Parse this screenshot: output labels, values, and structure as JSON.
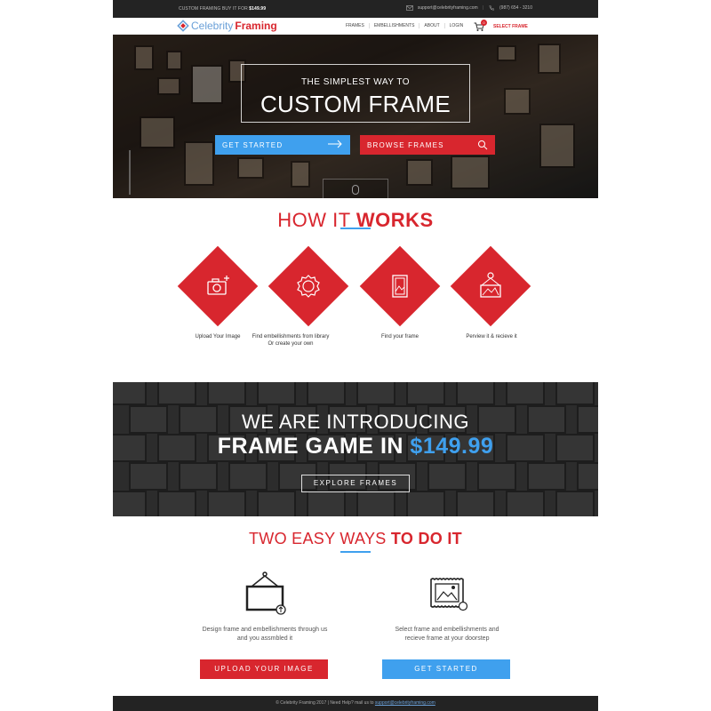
{
  "topbar": {
    "promo_text": "CUSTOM FRAMING BUY IT FOR",
    "promo_price": "$149.99",
    "email": "support@celebrityframing.com",
    "separator": "|",
    "phone": "(987) 654 - 3210"
  },
  "nav": {
    "logo_part1": "Celebrity",
    "logo_part2": "Framing",
    "menu": [
      "FRAMES",
      "EMBELLISHMENTS",
      "ABOUT",
      "LOGIN"
    ],
    "cart_count": "0",
    "select_frame": "SELECT FRAME"
  },
  "hero": {
    "line1": "THE SIMPLEST WAY TO",
    "line2": "CUSTOM FRAME",
    "get_started": "GET STARTED",
    "browse_frames": "BROWSE FRAMES"
  },
  "how": {
    "title_light": "HOW IT",
    "title_bold": "WORKS",
    "steps": [
      {
        "label": "Upload Your Image",
        "icon": "camera-icon"
      },
      {
        "label": "Find embellishments from library",
        "label2": "Or create your own",
        "icon": "badge-icon"
      },
      {
        "label": "Find your frame",
        "icon": "frame-icon"
      },
      {
        "label": "Perview it & recieve it",
        "icon": "hanging-picture-icon"
      }
    ]
  },
  "intro": {
    "line1": "WE ARE INTRODUCING",
    "line2_text": "FRAME GAME IN",
    "line2_price": "$149.99",
    "explore": "EXPLORE FRAMES"
  },
  "two_ways": {
    "title_light": "TWO EASY WAYS",
    "title_bold": "TO DO IT",
    "left_text1": "Design frame and embellishments through us",
    "left_text2": "and you assmbled it",
    "right_text1": "Select frame and embellishments and",
    "right_text2": "recieve frame at your doorstep",
    "upload_button": "UPLOAD YOUR IMAGE",
    "get_started_button": "GET STARTED"
  },
  "footer": {
    "text": "© Celebrity Framing 2017 | Need Help? mail us to",
    "email": "support@celebrityframing.com"
  },
  "colors": {
    "brand_red": "#d8262e",
    "brand_blue": "#3fa0ee",
    "dark": "#232323"
  }
}
